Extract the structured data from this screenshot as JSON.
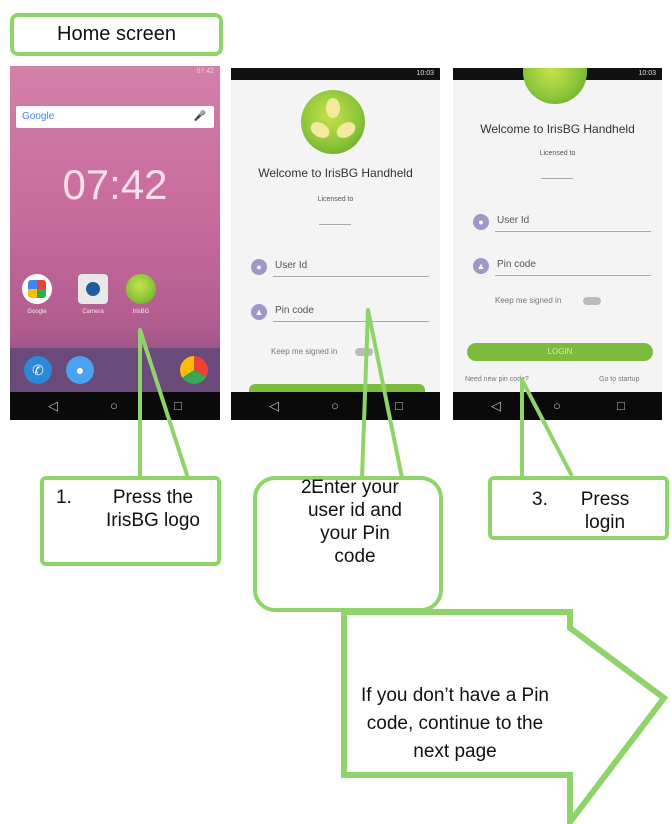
{
  "home_label": "Home screen",
  "home_phone": {
    "status_time": "07:42",
    "google": "Google",
    "clock": "07:42",
    "apps": [
      "Google",
      "Camera",
      "IrisBG"
    ]
  },
  "login_phone_1": {
    "status_time": "10:03",
    "welcome": "Welcome to IrisBG Handheld",
    "licensed": "Licensed to",
    "user_placeholder": "User Id",
    "pin_placeholder": "Pin code",
    "keep_signed": "Keep me signed in"
  },
  "login_phone_2": {
    "status_time": "10:03",
    "welcome": "Welcome to IrisBG Handheld",
    "licensed": "Licensed to",
    "user_placeholder": "User Id",
    "pin_placeholder": "Pin code",
    "keep_signed": "Keep me signed in",
    "login_button": "LOGIN",
    "need_pin": "Need new pin code?",
    "go_startup": "Go to startup"
  },
  "steps": {
    "step1": {
      "num": "1.",
      "text": "Press the IrisBG logo"
    },
    "step2": {
      "num": "2.",
      "text": "Enter your user id and your Pin code"
    },
    "step3": {
      "num": "3.",
      "text": "Press login"
    }
  },
  "arrow_note": "If you don’t have a Pin code, continue to the next page",
  "colors": {
    "accent": "#8fd46a",
    "input_icon": "#9d98c7",
    "login_green": "#7dbb3c"
  }
}
